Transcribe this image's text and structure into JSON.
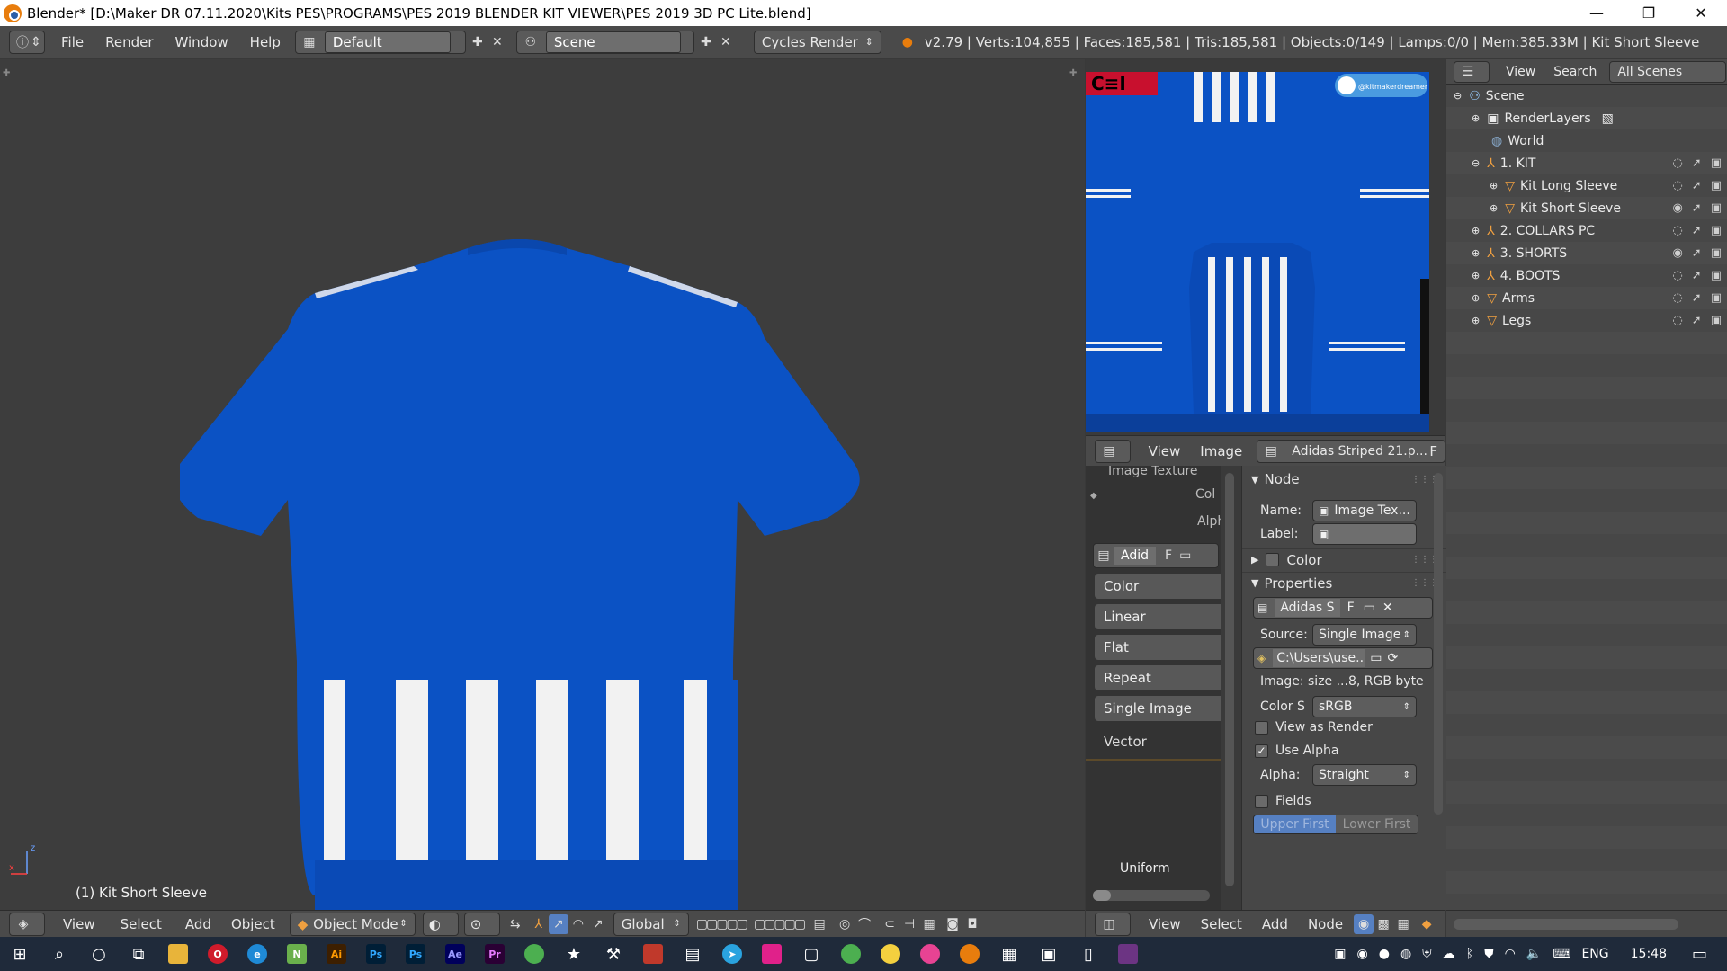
{
  "window": {
    "title": "Blender* [D:\\Maker DR 07.11.2020\\Kits PES\\PROGRAMS\\PES 2019 BLENDER KIT VIEWER\\PES 2019 3D PC Lite.blend]",
    "minimize": "—",
    "maximize": "❐",
    "close": "✕"
  },
  "infobar": {
    "menus": [
      "File",
      "Render",
      "Window",
      "Help"
    ],
    "layout": "Default",
    "scene": "Scene",
    "engine": "Cycles Render",
    "stats": "v2.79 | Verts:104,855 | Faces:185,581 | Tris:185,581 | Objects:0/149 | Lamps:0/0 | Mem:385.33M | Kit Short Sleeve"
  },
  "viewport": {
    "object_label": "(1) Kit Short Sleeve",
    "footer": {
      "menus": [
        "View",
        "Select",
        "Add",
        "Object"
      ],
      "mode": "Object Mode",
      "orientation": "Global"
    }
  },
  "uv_editor": {
    "header_menus": [
      "View",
      "Image"
    ],
    "image_name": "Adidas Striped 21.p...",
    "fake_user": "F",
    "twitter_handle": "@kitmakerdreamer"
  },
  "node_editor": {
    "partial_title": "Image Texture",
    "socket_col": "Col",
    "socket_alph": "Alph",
    "image_short": "Adid",
    "fake_user": "F",
    "options": [
      "Color",
      "Linear",
      "Flat",
      "Repeat",
      "Single Image"
    ],
    "vector": "Vector",
    "uniform": "Uniform",
    "footer_menus": [
      "View",
      "Select",
      "Add",
      "Node"
    ]
  },
  "node_panel": {
    "node_header": "Node",
    "name_label": "Name:",
    "name_value": "Image Tex...",
    "label_label": "Label:",
    "color_header": "Color",
    "properties_header": "Properties",
    "image_name": "Adidas S",
    "fake_user": "F",
    "source_label": "Source:",
    "source_value": "Single Image",
    "filepath": "C:\\Users\\use...",
    "image_info": "Image: size ...8, RGB byte",
    "colorspace_label": "Color S",
    "colorspace_value": "sRGB",
    "view_as_render": "View as Render",
    "use_alpha": "Use Alpha",
    "alpha_label": "Alpha:",
    "alpha_value": "Straight",
    "fields": "Fields",
    "upper_first": "Upper First",
    "lower_first": "Lower First"
  },
  "outliner": {
    "header_menus": [
      "View",
      "Search"
    ],
    "filter": "All Scenes",
    "items": [
      {
        "label": "Scene",
        "indent": 0,
        "icon": "scene-icon"
      },
      {
        "label": "RenderLayers",
        "indent": 1,
        "icon": "renderlayers-icon"
      },
      {
        "label": "World",
        "indent": 1,
        "icon": "world-icon"
      },
      {
        "label": "1. KIT",
        "indent": 1,
        "icon": "armature-icon"
      },
      {
        "label": "Kit Long Sleeve",
        "indent": 2,
        "icon": "mesh-icon"
      },
      {
        "label": "Kit Short Sleeve",
        "indent": 2,
        "icon": "mesh-icon"
      },
      {
        "label": "2. COLLARS PC",
        "indent": 1,
        "icon": "armature-icon"
      },
      {
        "label": "3. SHORTS",
        "indent": 1,
        "icon": "armature-icon"
      },
      {
        "label": "4. BOOTS",
        "indent": 1,
        "icon": "armature-icon"
      },
      {
        "label": "Arms",
        "indent": 1,
        "icon": "mesh-icon"
      },
      {
        "label": "Legs",
        "indent": 1,
        "icon": "mesh-icon"
      }
    ]
  },
  "taskbar": {
    "language": "ENG",
    "time": "15:48"
  },
  "colors": {
    "jersey_blue": "#0b52c4",
    "stripe_white": "#f2f2f2",
    "panel_bg": "#474747",
    "highlight_blue": "#5680c2"
  }
}
